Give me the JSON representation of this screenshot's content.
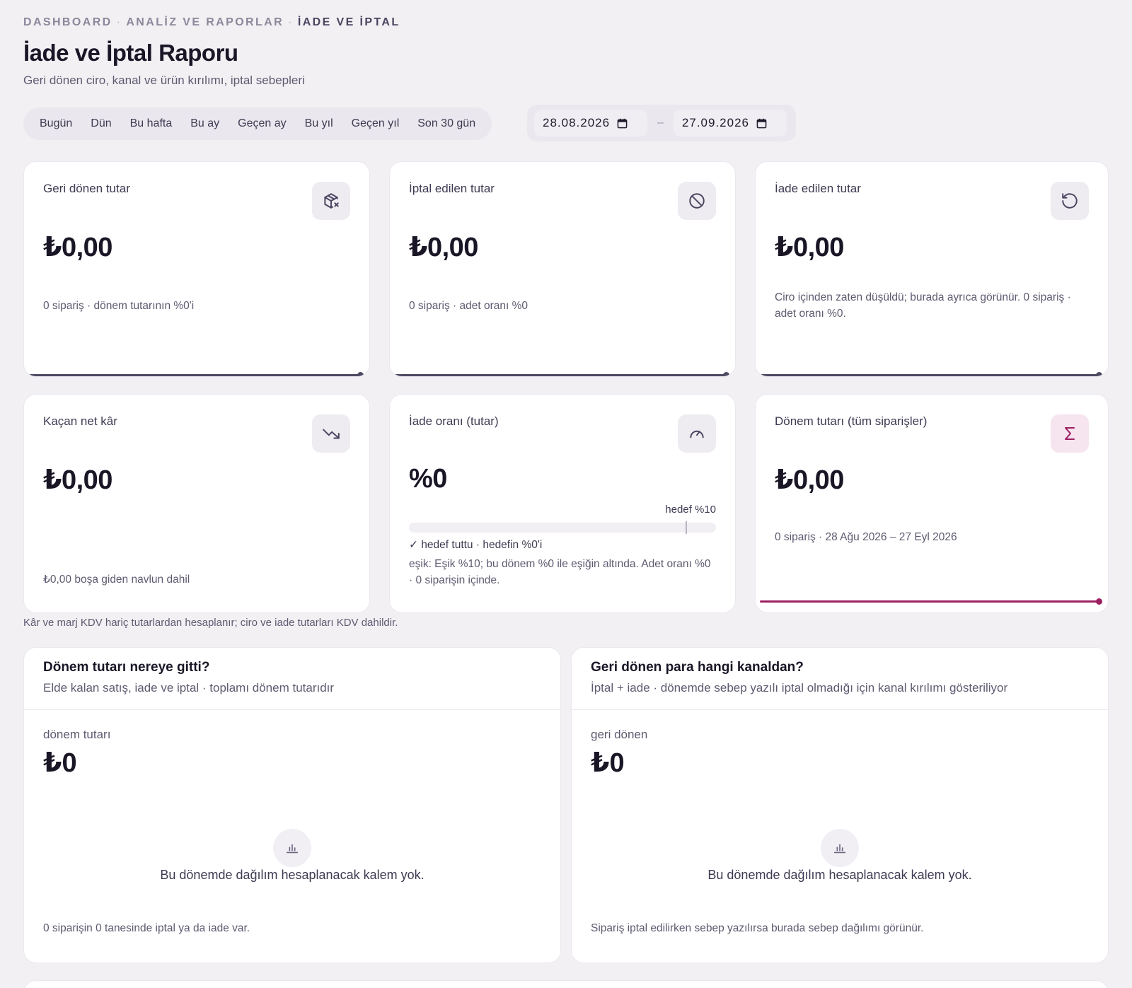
{
  "breadcrumb": {
    "items": [
      "DASHBOARD",
      "ANALİZ VE RAPORLAR",
      "İADE VE İPTAL"
    ],
    "separator": "·"
  },
  "page": {
    "title": "İade ve İptal Raporu",
    "subtitle": "Geri dönen ciro, kanal ve ürün kırılımı, iptal sebepleri"
  },
  "presets": [
    "Bugün",
    "Dün",
    "Bu hafta",
    "Bu ay",
    "Geçen ay",
    "Bu yıl",
    "Geçen yıl",
    "Son 30 gün"
  ],
  "date_range": {
    "start": "28.08.2026",
    "separator": "–",
    "end": "27.09.2026"
  },
  "kpis": [
    {
      "label": "Geri dönen tutar",
      "icon": "package-x-icon",
      "value": "₺0,00",
      "note": "0 sipariş · dönem tutarının %0'i"
    },
    {
      "label": "İptal edilen tutar",
      "icon": "ban-icon",
      "value": "₺0,00",
      "note": "0 sipariş · adet oranı %0"
    },
    {
      "label": "İade edilen tutar",
      "icon": "rotate-ccw-icon",
      "value": "₺0,00",
      "note": "Ciro içinden zaten düşüldü; burada ayrıca görünür. 0 sipariş · adet oranı %0."
    },
    {
      "label": "Kaçan net kâr",
      "icon": "trending-down-icon",
      "value": "₺0,00",
      "note": "₺0,00 boşa giden navlun dahil"
    },
    {
      "label": "İade oranı (tutar)",
      "icon": "gauge-icon",
      "value": "%0",
      "target_label": "hedef %10",
      "progress_fraction": 0,
      "target_fraction": 0.9,
      "status": "✓ hedef tuttu · hedefin %0'i",
      "note": "eşik: Eşik %10; bu dönem %0 ile eşiğin altında. Adet oranı %0 · 0 siparişin içinde."
    },
    {
      "label": "Dönem tutarı (tüm siparişler)",
      "icon": "sigma-icon",
      "value": "₺0,00",
      "note": "0 sipariş · 28 Ağu 2026 – 27 Eyl 2026"
    }
  ],
  "footnote": "Kâr ve marj KDV hariç tutarlardan hesaplanır; ciro ve iade tutarları KDV dahildir.",
  "panels": [
    {
      "title": "Dönem tutarı nereye gitti?",
      "subtitle": "Elde kalan satış, iade ve iptal · toplamı dönem tutarıdır",
      "metric_label": "dönem tutarı",
      "metric_value": "₺0",
      "icon": "bar-chart-icon",
      "empty_text": "Bu dönemde dağılım hesaplanacak kalem yok.",
      "foot": "0 siparişin 0 tanesinde iptal ya da iade var."
    },
    {
      "title": "Geri dönen para hangi kanaldan?",
      "subtitle": "İptal + iade · dönemde sebep yazılı iptal olmadığı için kanal kırılımı gösteriliyor",
      "metric_label": "geri dönen",
      "metric_value": "₺0",
      "icon": "bar-chart-icon",
      "empty_text": "Bu dönemde dağılım hesaplanacak kalem yok.",
      "foot": "Sipariş iptal edilirken sebep yazılırsa burada sebep dağılımı görünür."
    }
  ],
  "colors": {
    "accent": "#9c1f62",
    "bar": "#4d4a63",
    "background": "#f3f0f4"
  }
}
